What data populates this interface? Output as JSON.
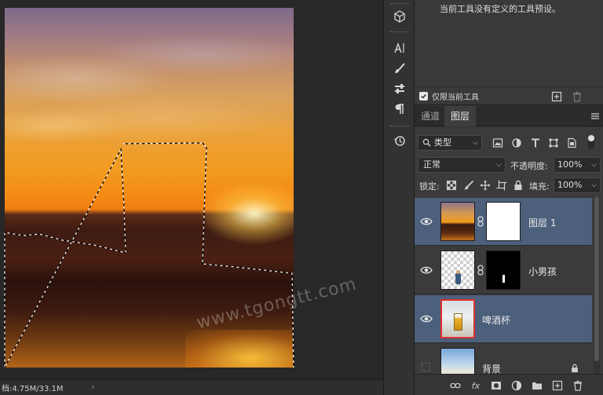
{
  "canvas": {
    "status_doc": "档:4.75M/33.1M",
    "status_arrow": "›"
  },
  "tool_presets": {
    "message": "当前工具没有定义的工具预设。",
    "only_current_label": "仅限当前工具",
    "only_current_checked": true
  },
  "tabs": [
    {
      "label": "通道",
      "active": false
    },
    {
      "label": "图层",
      "active": true
    }
  ],
  "layers_panel": {
    "filter_kind": "类型",
    "blend_mode": "正常",
    "opacity_label": "不透明度:",
    "opacity_value": "100%",
    "lock_label": "锁定:",
    "fill_label": "填充:",
    "fill_value": "100%",
    "layers": [
      {
        "name": "图层 1",
        "visible": true,
        "selected": true,
        "has_mask": true,
        "thumb": "sunset"
      },
      {
        "name": "小男孩",
        "visible": true,
        "selected": false,
        "has_mask": true,
        "thumb": "boy"
      },
      {
        "name": "啤酒杯",
        "visible": true,
        "selected": true,
        "has_mask": false,
        "thumb": "beer"
      },
      {
        "name": "背景",
        "visible": false,
        "selected": false,
        "has_mask": false,
        "thumb": "beach",
        "locked": true
      }
    ]
  },
  "watermark": "www.tgongtt.com",
  "colors": {
    "selected_layer": "#4c607c",
    "panel_bg": "#3b3b3b",
    "beer_thumb_border": "#e0302e"
  }
}
